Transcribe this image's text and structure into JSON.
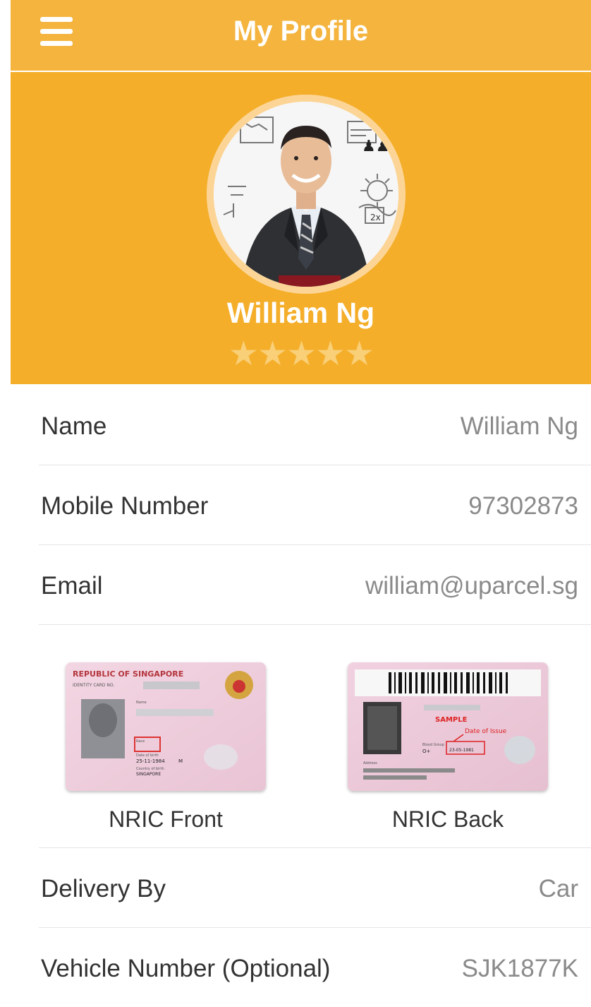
{
  "header": {
    "title": "My Profile",
    "menu_icon": "hamburger-menu-icon"
  },
  "profile": {
    "name": "William Ng",
    "rating": {
      "value": 5,
      "max": 5
    },
    "colors": {
      "header": "#F4B43E",
      "hero": "#F4AE2A",
      "ring": "#FCD596",
      "star": "#F9CF77"
    }
  },
  "fields": {
    "name": {
      "label": "Name",
      "value": "William Ng"
    },
    "mobile": {
      "label": "Mobile Number",
      "value": "97302873"
    },
    "email": {
      "label": "Email",
      "value": "william@uparcel.sg"
    },
    "delivery": {
      "label": "Delivery By",
      "value": "Car"
    },
    "vehicle": {
      "label": "Vehicle Number (Optional)",
      "value": "SJK1877K"
    }
  },
  "documents": {
    "front": {
      "caption": "NRIC Front",
      "card_title": "REPUBLIC OF SINGAPORE",
      "card_subtitle": "IDENTITY CARD NO.",
      "card_field_name": "Name",
      "card_field_race": "Race",
      "card_field_dob": "Date of birth",
      "card_dob": "25-11-1984",
      "card_sex": "M",
      "card_field_country": "Country of birth",
      "card_country": "SINGAPORE"
    },
    "back": {
      "caption": "NRIC Back",
      "sample_label": "SAMPLE",
      "issue_label": "Date of Issue",
      "issue_date": "23-05-1981",
      "blood_label": "Blood Group",
      "blood": "O+",
      "address_label": "Address"
    }
  }
}
